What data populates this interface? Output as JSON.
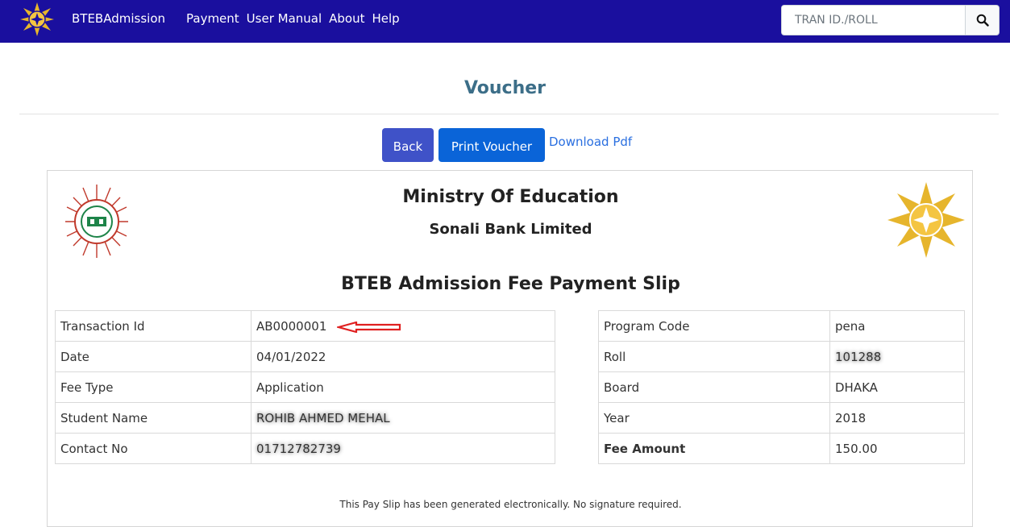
{
  "navbar": {
    "brand": "BTEBAdmission",
    "links": [
      "Payment",
      "User Manual",
      "About",
      "Help"
    ],
    "search_placeholder": "TRAN ID./ROLL",
    "bg_color": "#1a0f9e"
  },
  "page": {
    "title": "Voucher",
    "back_label": "Back",
    "print_label": "Print Voucher",
    "download_label": "Download Pdf"
  },
  "slip": {
    "ministry": "Ministry Of Education",
    "bank": "Sonali Bank Limited",
    "title": "BTEB Admission Fee Payment Slip",
    "left_rows": [
      {
        "label": "Transaction Id",
        "value": "AB0000001"
      },
      {
        "label": "Date",
        "value": "04/01/2022"
      },
      {
        "label": "Fee Type",
        "value": "Application"
      },
      {
        "label": "Student Name",
        "value": "ROHIB AHMED MEHAL"
      },
      {
        "label": "Contact No",
        "value": "01712782739"
      }
    ],
    "right_rows": [
      {
        "label": "Program Code",
        "value": "pena"
      },
      {
        "label": "Roll",
        "value": "101288"
      },
      {
        "label": "Board",
        "value": "DHAKA"
      },
      {
        "label": "Year",
        "value": "2018"
      },
      {
        "label": "Fee Amount",
        "value": "150.00"
      }
    ],
    "note": "This Pay Slip has been generated electronically. No signature required."
  }
}
